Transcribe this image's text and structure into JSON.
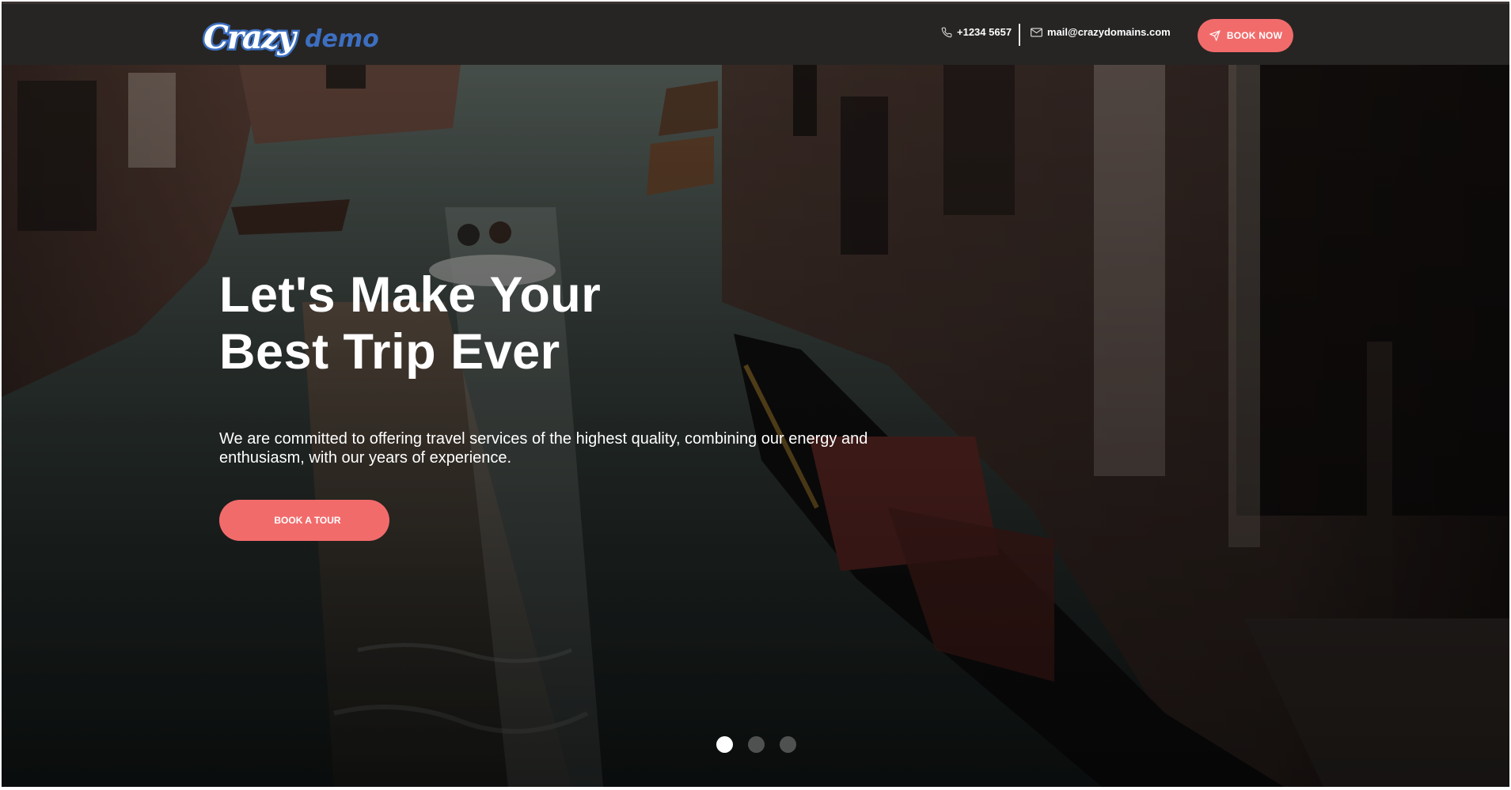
{
  "header": {
    "logo": {
      "part1": "Crazy",
      "part2": "demo"
    },
    "phone": "+1234 5657",
    "email": "mail@crazydomains.com",
    "book_now_label": "BOOK NOW"
  },
  "hero": {
    "title_line1": "Let's Make Your",
    "title_line2": "Best Trip Ever",
    "description": "We are committed to offering travel services of the highest quality, combining our energy and enthusiasm, with our years of experience.",
    "cta_label": "BOOK A TOUR",
    "cta_icon": "",
    "slides": [
      {
        "active": true
      },
      {
        "active": false
      },
      {
        "active": false
      }
    ]
  },
  "colors": {
    "accent": "#f26b6b",
    "header_bg": "#262524",
    "logo_blue": "#3d6fc0",
    "logo_red": "#e0302b"
  },
  "icons": {
    "phone": "phone-icon",
    "email": "envelope-icon",
    "book_now": "paper-plane-icon"
  }
}
